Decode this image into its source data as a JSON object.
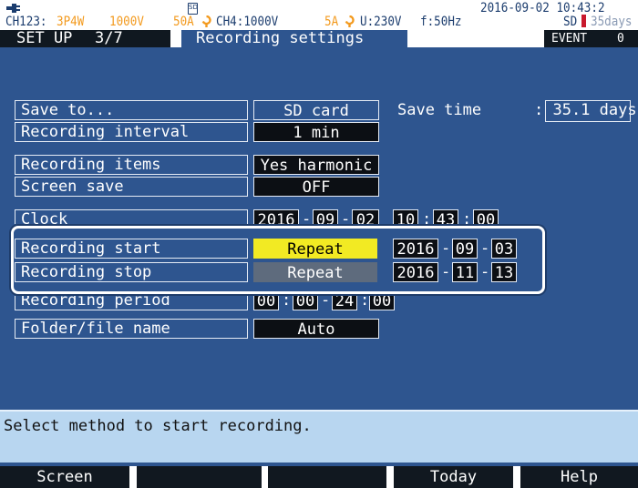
{
  "status": {
    "plug_icon": "plug-icon",
    "sd_icon": "sd-card-icon",
    "sd_icon_text": "SD",
    "datetime": "2016-09-02 10:43:2",
    "channel": "CH123:",
    "wiring": "3P4W",
    "voltage_range": "1000V",
    "current_range": "50A",
    "clamp_icon": "clamp-sensor-icon",
    "ch4": "CH4:1000V",
    "ch4_current": "5A",
    "u_param": "U:230V",
    "freq": "f:50Hz",
    "sd_label": "SD",
    "sd_days": "35days",
    "accent_orange": "#f39a1e"
  },
  "title": {
    "setup": "SET UP",
    "page": "3/7",
    "screen_name": "Recording settings",
    "event_label": "EVENT",
    "event_count": "0"
  },
  "settings": {
    "save_to": {
      "label": "Save to...",
      "value": "SD card"
    },
    "save_time": {
      "label": "Save time",
      "value": ": 35.1 days"
    },
    "recording_interval": {
      "label": "Recording interval",
      "value": "1 min"
    },
    "recording_items": {
      "label": "Recording items",
      "value": "Yes harmonic"
    },
    "screen_save": {
      "label": "Screen save",
      "value": "OFF"
    },
    "clock": {
      "label": "Clock",
      "year": "2016",
      "month": "09",
      "day": "02",
      "hour": "10",
      "minute": "43",
      "second": "00"
    },
    "recording_start": {
      "label": "Recording start",
      "mode": "Repeat",
      "year": "2016",
      "month": "09",
      "day": "03"
    },
    "recording_stop": {
      "label": "Recording stop",
      "mode": "Repeat",
      "year": "2016",
      "month": "11",
      "day": "13"
    },
    "recording_period": {
      "label": "Recording period",
      "h1": "00",
      "m1": "00",
      "h2": "24",
      "m2": "00"
    },
    "folder_file_name": {
      "label": "Folder/file name",
      "value": "Auto"
    }
  },
  "message": "Select method to start recording.",
  "fkeys": [
    "Screen",
    "",
    "",
    "Today",
    "Help"
  ],
  "colors": {
    "background": "#2e558f",
    "selected": "#f2ea23",
    "message_bg": "#b8d6f0"
  }
}
